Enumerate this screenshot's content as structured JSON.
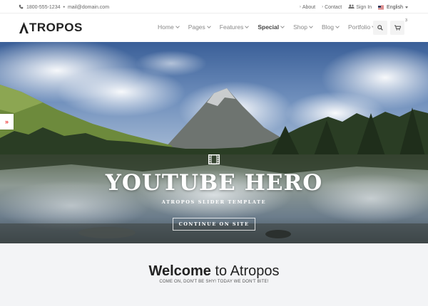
{
  "topbar": {
    "phone": "1800-555-1234",
    "separator": "•",
    "email": "mail@domain.com",
    "links": {
      "about": "About",
      "contact": "Contact",
      "signin": "Sign In",
      "language": "English"
    }
  },
  "header": {
    "logo": "TROPOS",
    "nav": [
      {
        "label": "Home"
      },
      {
        "label": "Pages"
      },
      {
        "label": "Features"
      },
      {
        "label": "Special"
      },
      {
        "label": "Shop"
      },
      {
        "label": "Blog"
      },
      {
        "label": "Portfolio"
      }
    ],
    "cart_count": "3"
  },
  "hero": {
    "title": "YOUTUBE HERO",
    "subtitle": "ATROPOS SLIDER TEMPLATE",
    "button": "CONTINUE ON SITE",
    "side_tab": "»"
  },
  "welcome": {
    "title_bold": "Welcome",
    "title_rest": " to Atropos",
    "subtitle": "COME ON, DON'T BE SHY! TODAY WE DON'T BITE!"
  },
  "colors": {
    "accent": "#e33333",
    "dark": "#222222",
    "welcome_bg": "#f3f4f6"
  }
}
